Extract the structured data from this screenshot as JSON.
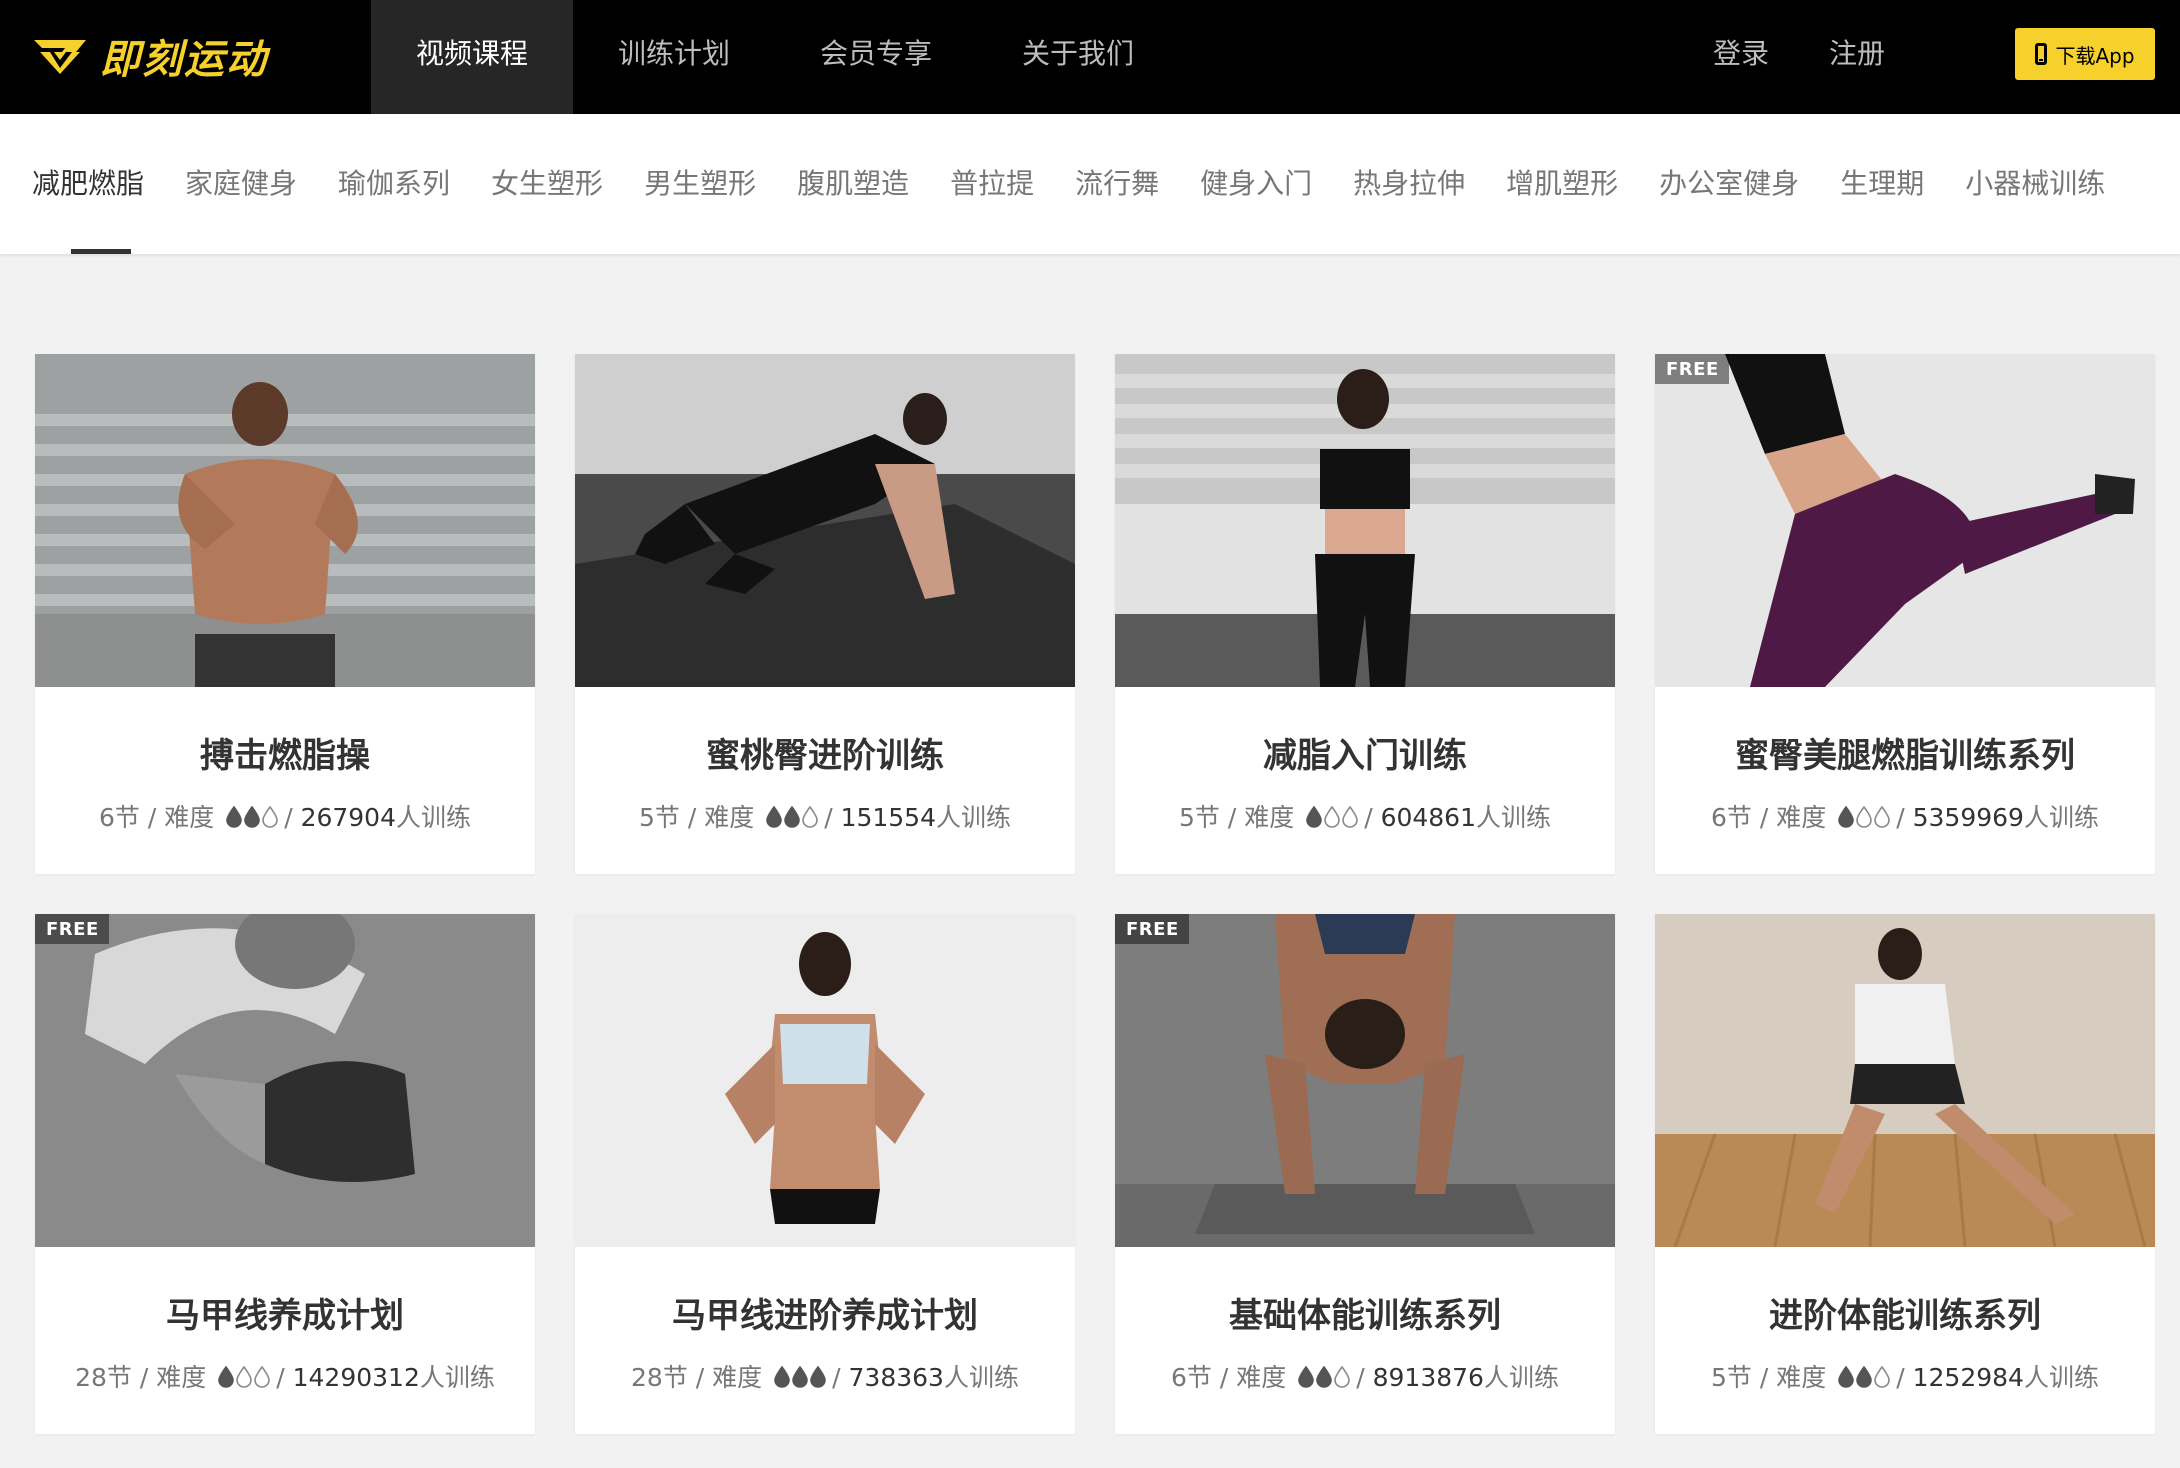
{
  "brand": {
    "name": "即刻运动",
    "color": "#f6d12b"
  },
  "nav": {
    "items": [
      {
        "label": "视频课程",
        "active": true
      },
      {
        "label": "训练计划",
        "active": false
      },
      {
        "label": "会员专享",
        "active": false
      },
      {
        "label": "关于我们",
        "active": false
      }
    ],
    "login": "登录",
    "register": "注册",
    "download": "下载App"
  },
  "categories": [
    {
      "label": "减肥燃脂",
      "active": true
    },
    {
      "label": "家庭健身"
    },
    {
      "label": "瑜伽系列"
    },
    {
      "label": "女生塑形"
    },
    {
      "label": "男生塑形"
    },
    {
      "label": "腹肌塑造"
    },
    {
      "label": "普拉提"
    },
    {
      "label": "流行舞"
    },
    {
      "label": "健身入门"
    },
    {
      "label": "热身拉伸"
    },
    {
      "label": "增肌塑形"
    },
    {
      "label": "办公室健身"
    },
    {
      "label": "生理期"
    },
    {
      "label": "小器械训练"
    }
  ],
  "courses": [
    {
      "title": "搏击燃脂操",
      "lessons": "6节",
      "difficulty_label": "难度",
      "difficulty": 2,
      "trainees": "267904",
      "trainees_suffix": "人训练",
      "free": false,
      "free_label": ""
    },
    {
      "title": "蜜桃臀进阶训练",
      "lessons": "5节",
      "difficulty_label": "难度",
      "difficulty": 2,
      "trainees": "151554",
      "trainees_suffix": "人训练",
      "free": false,
      "free_label": ""
    },
    {
      "title": "减脂入门训练",
      "lessons": "5节",
      "difficulty_label": "难度",
      "difficulty": 1,
      "trainees": "604861",
      "trainees_suffix": "人训练",
      "free": false,
      "free_label": ""
    },
    {
      "title": "蜜臀美腿燃脂训练系列",
      "lessons": "6节",
      "difficulty_label": "难度",
      "difficulty": 1,
      "trainees": "5359969",
      "trainees_suffix": "人训练",
      "free": true,
      "free_label": "FREE"
    },
    {
      "title": "马甲线养成计划",
      "lessons": "28节",
      "difficulty_label": "难度",
      "difficulty": 1,
      "trainees": "14290312",
      "trainees_suffix": "人训练",
      "free": true,
      "free_label": "FREE"
    },
    {
      "title": "马甲线进阶养成计划",
      "lessons": "28节",
      "difficulty_label": "难度",
      "difficulty": 3,
      "trainees": "738363",
      "trainees_suffix": "人训练",
      "free": false,
      "free_label": ""
    },
    {
      "title": "基础体能训练系列",
      "lessons": "6节",
      "difficulty_label": "难度",
      "difficulty": 2,
      "trainees": "8913876",
      "trainees_suffix": "人训练",
      "free": true,
      "free_label": "FREE"
    },
    {
      "title": "进阶体能训练系列",
      "lessons": "5节",
      "difficulty_label": "难度",
      "difficulty": 2,
      "trainees": "1252984",
      "trainees_suffix": "人训练",
      "free": false,
      "free_label": ""
    }
  ]
}
